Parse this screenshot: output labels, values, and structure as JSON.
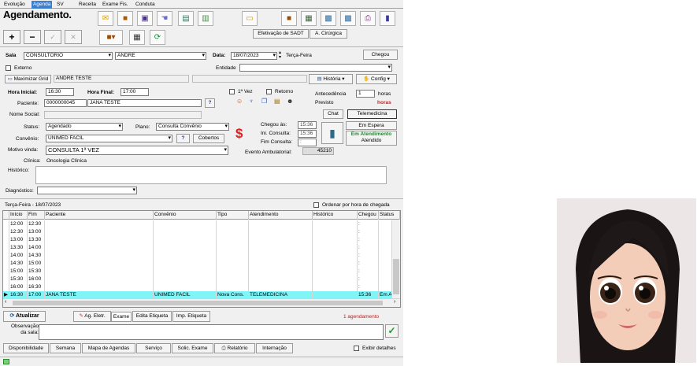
{
  "tabs": [
    "Evolução",
    "Agenda",
    "SV",
    "Receita",
    "Exame Fis.",
    "Conduta"
  ],
  "title": "Agendamento.",
  "toolbar": {
    "add": "+",
    "remove": "−",
    "confirm": "✓",
    "cancel": "✕",
    "sadt": "Efetivação de SADT",
    "cirurgica": "A. Cirúrgica"
  },
  "sala": {
    "label": "Sala",
    "value": "CONSULTORIO",
    "doctor": "ANDRE",
    "data_label": "Data:",
    "date": "18/07/2023",
    "weekday": "Terça-Feira",
    "chegou": "Chegou"
  },
  "externo": "Externo",
  "entidade": "Entidade",
  "maximizar": "Maximizar Grid",
  "patient_bar": "ANDRE TESTE",
  "historia": "História",
  "config": "Config",
  "form": {
    "hora_inicial_label": "Hora Inicial:",
    "hora_inicial": "16:30",
    "hora_final_label": "Hora Final:",
    "hora_final": "17:00",
    "primeira_vez": "1ª Vez",
    "retorno": "Retorno",
    "antecedencia": "Antecedência",
    "antecedencia_val": "1",
    "horas": "horas",
    "previsto": "Previsto",
    "horas_red": "horas",
    "paciente_label": "Paciente:",
    "paciente_id": "0000000045",
    "paciente_nome": "JANA TESTE",
    "nome_social": "Nome Social:",
    "chat": "Chat",
    "telemedicina": "Telemedicina",
    "status_label": "Status:",
    "status": "Agendado",
    "plano_label": "Plano:",
    "plano": "Consulta Convênio",
    "chegou_as": "Chegou às:",
    "chegou_val": "15:36",
    "ini_consulta": "Ini. Consulta:",
    "ini_val": "15:36",
    "fim_consulta": "Fim Consulta:",
    "fim_val": ":",
    "em_espera": "Em Espera",
    "em_atendimento": "Em Atendimento",
    "atendido": "Atendido",
    "convenio_label": "Convênio:",
    "convenio": "UNIMED FACIL",
    "cobertos": "Cobertos",
    "motivo_label": "Motivo vinda:",
    "motivo": "CONSULTA 1ª VEZ",
    "evento_label": "Evento Ambulatorial:",
    "evento": "45210",
    "clinica_label": "Clínica:",
    "clinica": "Oncologia Clínica",
    "historico": "Histórico:",
    "diagnostico": "Diagnóstico:"
  },
  "day_label": "Terça-Feira - 18/07/2023",
  "ordenar": "Ordenar por hora de chegada",
  "grid": {
    "headers": [
      "Início",
      "Fim",
      "Paciente",
      "Convênio",
      "Tipo",
      "Atendimento",
      "Histórico",
      "Chegou",
      "Status"
    ],
    "rows": [
      [
        "12:00",
        "12:30",
        "",
        "",
        "",
        "",
        "",
        ":",
        ""
      ],
      [
        "12:30",
        "13:00",
        "",
        "",
        "",
        "",
        "",
        ":",
        ""
      ],
      [
        "13:00",
        "13:30",
        "",
        "",
        "",
        "",
        "",
        ":",
        ""
      ],
      [
        "13:30",
        "14:00",
        "",
        "",
        "",
        "",
        "",
        ":",
        ""
      ],
      [
        "14:00",
        "14:30",
        "",
        "",
        "",
        "",
        "",
        ":",
        ""
      ],
      [
        "14:30",
        "15:00",
        "",
        "",
        "",
        "",
        "",
        ":",
        ""
      ],
      [
        "15:00",
        "15:30",
        "",
        "",
        "",
        "",
        "",
        ":",
        ""
      ],
      [
        "15:30",
        "16:00",
        "",
        "",
        "",
        "",
        "",
        ":",
        ""
      ],
      [
        "16:00",
        "16:30",
        "",
        "",
        "",
        "",
        "",
        ":",
        ""
      ],
      [
        "16:30",
        "17:00",
        "JANA TESTE",
        "UNIMED FACIL",
        "Nova Cons.",
        "TELEMEDICINA",
        "",
        "15:36",
        "Em At"
      ]
    ]
  },
  "bottom": {
    "atualizar": "Atualizar",
    "ag_eletr": "Ag. Eletr.",
    "exame": "Exame",
    "edita_etiqueta": "Edita Etiqueta",
    "imp_etiqueta": "Imp. Etiqueta",
    "count": "1 agendamento",
    "observacao": "Observação da sala:"
  },
  "footer": [
    "Disponibilidade",
    "Semana",
    "Mapa de Agendas",
    "Serviço",
    "Solic. Exame",
    "Relatório",
    "Internação"
  ],
  "exibir": "Exibir detalhes"
}
